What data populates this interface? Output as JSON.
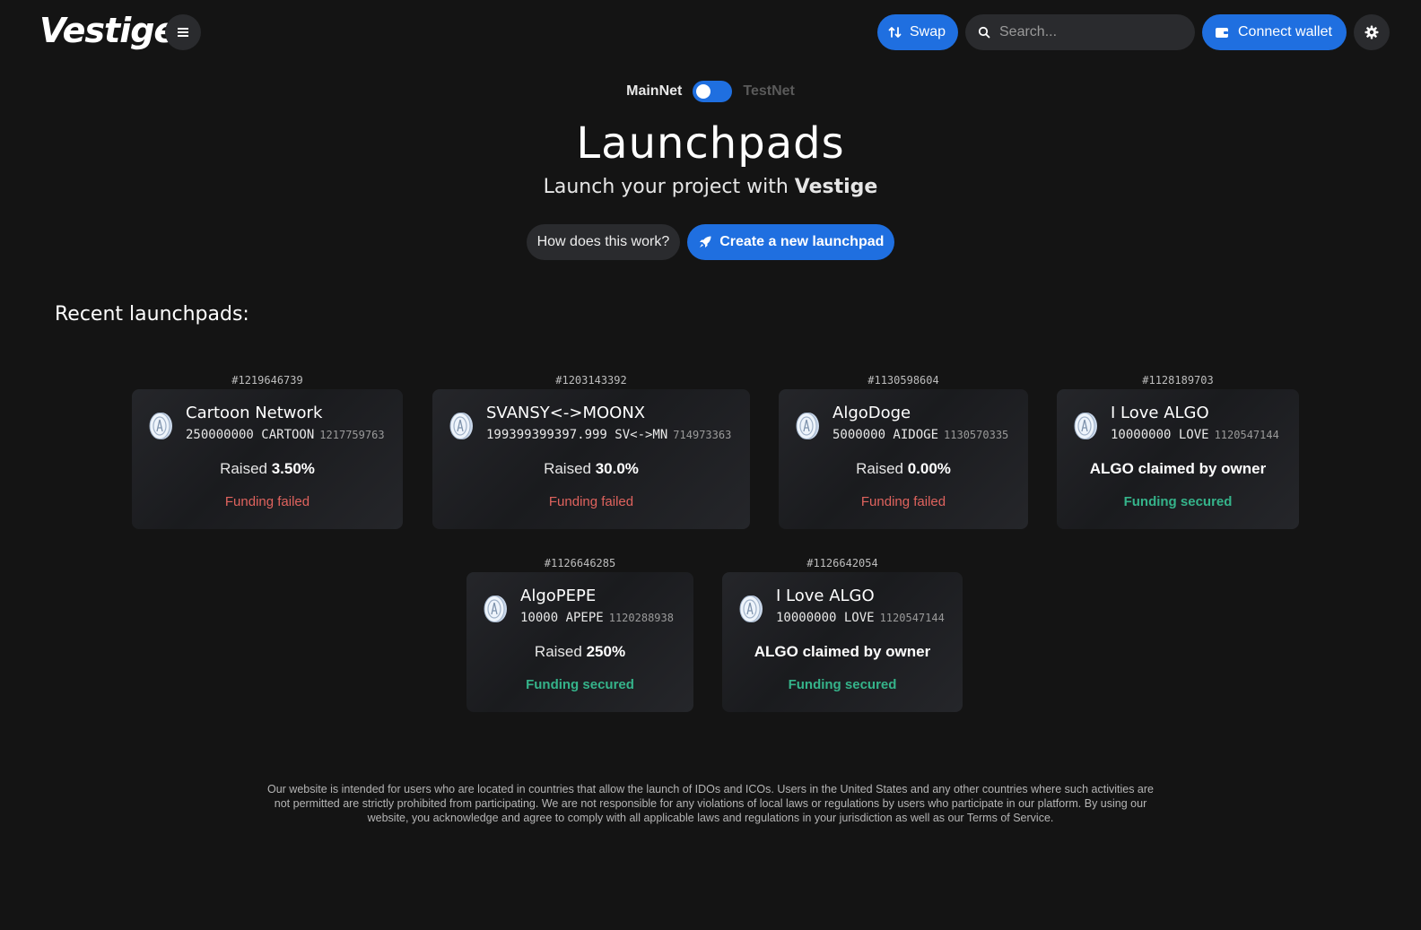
{
  "header": {
    "logo": "Vestige",
    "swap_label": "Swap",
    "search_placeholder": "Search...",
    "connect_label": "Connect wallet"
  },
  "network": {
    "mainnet_label": "MainNet",
    "testnet_label": "TestNet",
    "selected": "MainNet"
  },
  "hero": {
    "title": "Launchpads",
    "subtitle_prefix": "Launch your project with",
    "subtitle_brand": "Vestige",
    "how_label": "How does this work?",
    "create_label": "Create a new launchpad"
  },
  "recent": {
    "title": "Recent launchpads:",
    "cards": [
      {
        "id": "#1219646739",
        "name": "Cartoon Network",
        "amount": "250000000 CARTOON",
        "asset": "1217759763",
        "raised_label": "Raised",
        "raised_value": "3.50%",
        "status": "Funding failed",
        "status_type": "failed"
      },
      {
        "id": "#1203143392",
        "name": "SVANSY<->MOONX",
        "amount": "199399399397.999 SV<->MN",
        "asset": "714973363",
        "raised_label": "Raised",
        "raised_value": "30.0%",
        "status": "Funding failed",
        "status_type": "failed"
      },
      {
        "id": "#1130598604",
        "name": "AlgoDoge",
        "amount": "5000000 AIDOGE",
        "asset": "1130570335",
        "raised_label": "Raised",
        "raised_value": "0.00%",
        "status": "Funding failed",
        "status_type": "failed"
      },
      {
        "id": "#1128189703",
        "name": "I Love ALGO",
        "amount": "10000000 LOVE",
        "asset": "1120547144",
        "raised_label": "",
        "raised_value": "ALGO claimed by owner",
        "status": "Funding secured",
        "status_type": "secured"
      },
      {
        "id": "#1126646285",
        "name": "AlgoPEPE",
        "amount": "10000 APEPE",
        "asset": "1120288938",
        "raised_label": "Raised",
        "raised_value": "250%",
        "status": "Funding secured",
        "status_type": "secured"
      },
      {
        "id": "#1126642054",
        "name": "I Love ALGO",
        "amount": "10000000 LOVE",
        "asset": "1120547144",
        "raised_label": "",
        "raised_value": "ALGO claimed by owner",
        "status": "Funding secured",
        "status_type": "secured"
      }
    ]
  },
  "footer": {
    "disclaimer": "Our website is intended for users who are located in countries that allow the launch of IDOs and ICOs. Users in the United States and any other countries where such activities are not permitted are strictly prohibited from participating. We are not responsible for any violations of local laws or regulations by users who participate in our platform. By using our website, you acknowledge and agree to comply with all applicable laws and regulations in your jurisdiction as well as our Terms of Service."
  },
  "colors": {
    "accent": "#1f6fe0",
    "background": "#141414",
    "failed": "#e0635e",
    "secured": "#35b38a"
  },
  "icons": [
    "menu-icon",
    "swap-icon",
    "search-icon",
    "wallet-icon",
    "gear-icon",
    "rocket-icon",
    "coin-icon"
  ]
}
